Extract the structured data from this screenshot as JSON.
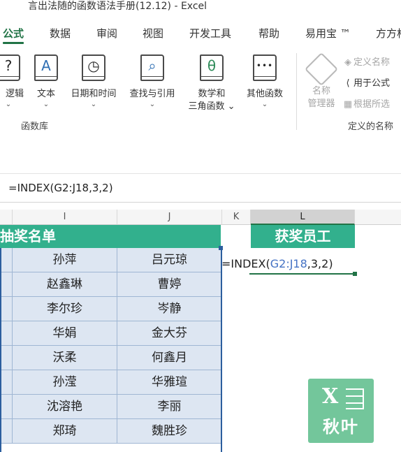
{
  "window": {
    "title": "言出法随的函数语法手册(12.12)  -  Excel"
  },
  "ribbon_tabs": [
    {
      "label": "公式",
      "active": true
    },
    {
      "label": "数据"
    },
    {
      "label": "审阅"
    },
    {
      "label": "视图"
    },
    {
      "label": "开发工具"
    },
    {
      "label": "帮助"
    },
    {
      "label": "易用宝 ™"
    },
    {
      "label": "方方格"
    }
  ],
  "function_library": {
    "group_label": "函数库",
    "buttons": [
      {
        "icon": "logical-icon",
        "glyph": "?",
        "label": "逻辑",
        "chevron": "⌄"
      },
      {
        "icon": "text-icon",
        "glyph": "A",
        "label": "文本",
        "chevron": "⌄"
      },
      {
        "icon": "clock-icon",
        "glyph": "◷",
        "label": "日期和时间",
        "chevron": "⌄"
      },
      {
        "icon": "lookup-icon",
        "glyph": "⌕",
        "label": "查找与引用",
        "chevron": "⌄"
      },
      {
        "icon": "theta-icon",
        "glyph": "θ",
        "label": "数学和\n三角函数 ⌄"
      },
      {
        "icon": "more-functions-icon",
        "glyph": "•••",
        "label": "其他函数",
        "chevron": "⌄"
      }
    ]
  },
  "defined_names": {
    "group_label": "定义的名称",
    "name_manager_label": "名称\n管理器",
    "define_name": "定义名称",
    "use_in_formula": "用于公式",
    "create_from_selection": "根据所选"
  },
  "formula_bar": {
    "formula": "=INDEX(G2:J18,3,2)"
  },
  "columns": {
    "i": "I",
    "j": "J",
    "k": "K",
    "l": "L"
  },
  "sheet": {
    "header_left": "抽奖名单",
    "header_right": "获奖员工",
    "rows": [
      {
        "i": "孙萍",
        "j": "吕元琼"
      },
      {
        "i": "赵鑫琳",
        "j": "曹婷"
      },
      {
        "i": "李尔珍",
        "j": "岑静"
      },
      {
        "i": "华娟",
        "j": "金大芬"
      },
      {
        "i": "沃柔",
        "j": "何鑫月"
      },
      {
        "i": "孙滢",
        "j": "华雅瑄"
      },
      {
        "i": "沈溶艳",
        "j": "李丽"
      },
      {
        "i": "郑琦",
        "j": "魏胜珍"
      }
    ],
    "edit_cell": {
      "prefix": "=INDEX(",
      "ref": "G2:J18",
      "suffix": ",3,2)"
    }
  },
  "watermark": {
    "brand": "秋叶",
    "letter": "X"
  },
  "colors": {
    "accent": "#217346",
    "band": "#32b08d",
    "cell_fill": "#dde6f2",
    "range_border": "#2c5e9e"
  }
}
